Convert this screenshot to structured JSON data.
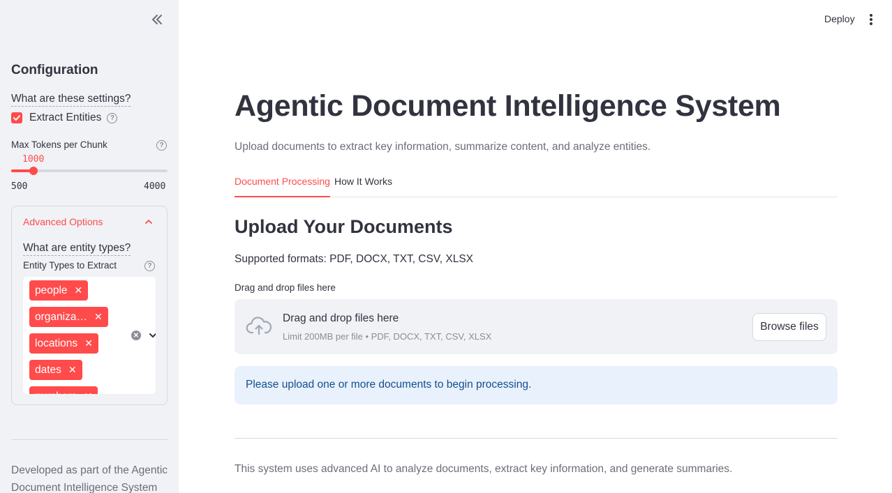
{
  "sidebar": {
    "title": "Configuration",
    "settings_help": "What are these settings?",
    "extract_entities": {
      "label": "Extract Entities",
      "checked": true
    },
    "slider": {
      "label": "Max Tokens per Chunk",
      "value": "1000",
      "min": "500",
      "max": "4000",
      "fraction": 0.143
    },
    "advanced": {
      "header": "Advanced Options",
      "help_link": "What are entity types?",
      "multiselect_label": "Entity Types to Extract",
      "tags": [
        "people",
        "organiza…",
        "locations",
        "dates",
        "numbers"
      ]
    },
    "footer": "Developed as part of the Agentic Document Intelligence System"
  },
  "header": {
    "deploy_label": "Deploy",
    "menu_icon": "more-vert-icon"
  },
  "main": {
    "title": "Agentic Document Intelligence System",
    "subtitle": "Upload documents to extract key information, summarize content, and analyze entities.",
    "tabs": [
      {
        "label": "Document Processing",
        "active": true
      },
      {
        "label": "How It Works",
        "active": false
      }
    ],
    "section_title": "Upload Your Documents",
    "supported_formats": "Supported formats: PDF, DOCX, TXT, CSV, XLSX",
    "uploader": {
      "label": "Drag and drop files here",
      "title": "Drag and drop files here",
      "limit": "Limit 200MB per file • PDF, DOCX, TXT, CSV, XLSX",
      "browse_label": "Browse files",
      "icon": "cloud-upload-icon"
    },
    "info_message": "Please upload one or more documents to begin processing.",
    "footer": "This system uses advanced AI to analyze documents, extract key information, and generate summaries."
  },
  "colors": {
    "accent": "#ff4b4b",
    "sidebar_bg": "#f0f2f6",
    "info_bg": "#e9f1fd",
    "info_text": "#124f8c",
    "text": "#31333f"
  }
}
